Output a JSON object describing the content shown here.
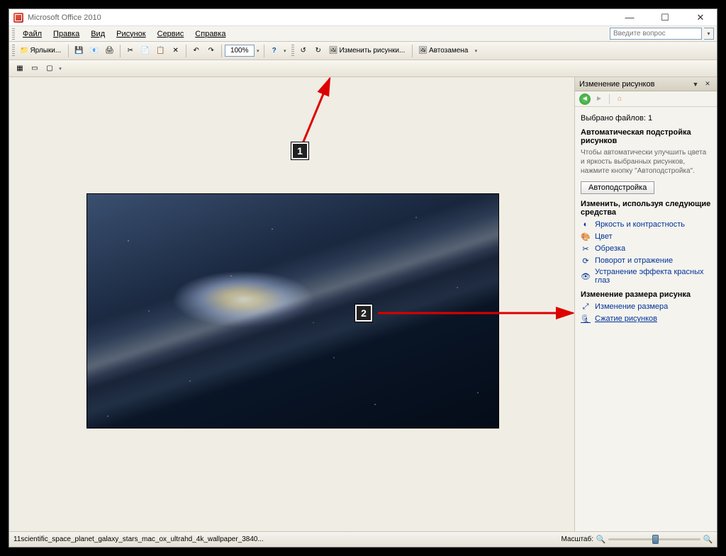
{
  "title": "Microsoft Office 2010",
  "menu": {
    "file": "Файл",
    "edit": "Правка",
    "view": "Вид",
    "picture": "Рисунок",
    "service": "Сервис",
    "help": "Справка",
    "question_placeholder": "Введите вопрос"
  },
  "toolbar": {
    "shortcuts": "Ярлыки...",
    "zoom": "100%",
    "edit_pictures": "Изменить рисунки...",
    "autoreplace": "Автозамена"
  },
  "taskpane": {
    "title": "Изменение рисунков",
    "selected": "Выбрано файлов: 1",
    "auto_section": "Автоматическая подстройка рисунков",
    "auto_help": "Чтобы автоматически улучшить цвета и яркость выбранных рисунков, нажмите кнопку \"Автоподстройка\".",
    "auto_btn": "Автоподстройка",
    "tools_section": "Изменить, используя следующие средства",
    "brightness": "Яркость и контрастность",
    "color": "Цвет",
    "crop": "Обрезка",
    "rotate": "Поворот и отражение",
    "redeye": "Устранение эффекта красных глаз",
    "size_section": "Изменение размера рисунка",
    "resize": "Изменение размера",
    "compress": "Сжатие рисунков"
  },
  "statusbar": {
    "filename": "11scientific_space_planet_galaxy_stars_mac_ox_ultrahd_4k_wallpaper_3840...",
    "scale_label": "Масштаб:"
  },
  "annotations": {
    "n1": "1",
    "n2": "2"
  }
}
